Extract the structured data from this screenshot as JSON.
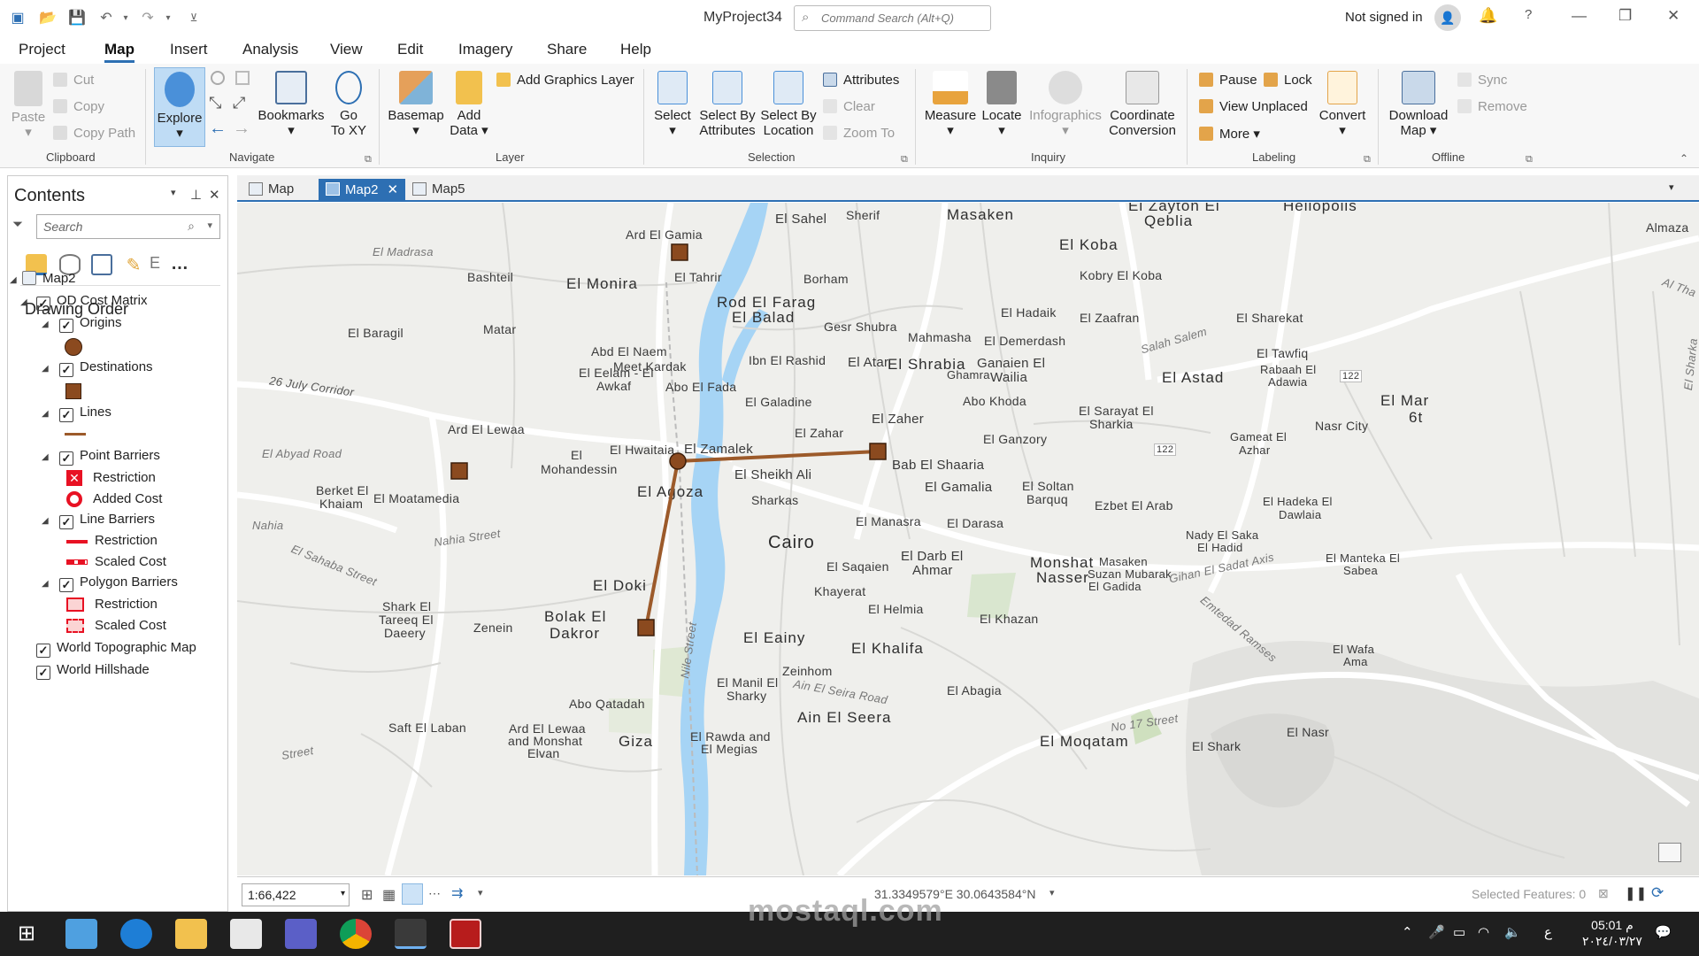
{
  "title_bar": {
    "project_name": "MyProject34",
    "command_search_placeholder": "Command Search (Alt+Q)",
    "sign_in": "Not signed in",
    "help": "?"
  },
  "menu": [
    "Project",
    "Map",
    "Insert",
    "Analysis",
    "View",
    "Edit",
    "Imagery",
    "Share",
    "Help"
  ],
  "active_menu": "Map",
  "ribbon": {
    "clipboard": {
      "label": "Clipboard",
      "paste": "Paste",
      "cut": "Cut",
      "copy": "Copy",
      "copy_path": "Copy Path"
    },
    "navigate": {
      "label": "Navigate",
      "explore": "Explore",
      "bookmarks": "Bookmarks",
      "go_to_xy_1": "Go",
      "go_to_xy_2": "To XY"
    },
    "layer": {
      "label": "Layer",
      "basemap": "Basemap",
      "add_data_1": "Add",
      "add_data_2": "Data",
      "add_graphics_layer": "Add Graphics Layer"
    },
    "selection": {
      "label": "Selection",
      "select": "Select",
      "select_by_attributes_1": "Select By",
      "select_by_attributes_2": "Attributes",
      "select_by_location_1": "Select By",
      "select_by_location_2": "Location",
      "attributes": "Attributes",
      "clear": "Clear",
      "zoom_to": "Zoom To"
    },
    "inquiry": {
      "label": "Inquiry",
      "measure": "Measure",
      "locate": "Locate",
      "infographics": "Infographics",
      "coordinate_conversion_1": "Coordinate",
      "coordinate_conversion_2": "Conversion"
    },
    "labeling": {
      "label": "Labeling",
      "pause": "Pause",
      "lock": "Lock",
      "view_unplaced": "View Unplaced",
      "more": "More",
      "convert": "Convert"
    },
    "offline": {
      "label": "Offline",
      "download_map_1": "Download",
      "download_map_2": "Map",
      "sync": "Sync",
      "remove": "Remove"
    }
  },
  "contents": {
    "title": "Contents",
    "search_placeholder": "Search",
    "drawing_order": "Drawing Order",
    "map_name": "Map2",
    "layers": {
      "od_cost_matrix": "OD Cost Matrix",
      "origins": "Origins",
      "destinations": "Destinations",
      "lines": "Lines",
      "point_barriers": "Point Barriers",
      "pb_restriction": "Restriction",
      "pb_added_cost": "Added Cost",
      "line_barriers": "Line Barriers",
      "lb_restriction": "Restriction",
      "lb_scaled_cost": "Scaled Cost",
      "polygon_barriers": "Polygon Barriers",
      "pgb_restriction": "Restriction",
      "pgb_scaled_cost": "Scaled Cost",
      "world_topo": "World Topographic Map",
      "world_hillshade": "World Hillshade"
    }
  },
  "map_tabs": [
    "Map",
    "Map2",
    "Map5"
  ],
  "active_tab": "Map2",
  "map_labels": {
    "el_sahel": "El Sahel",
    "sherif": "Sherif",
    "masaken": "Masaken",
    "el_zayton_qeblia_1": "El Zayton El",
    "el_zayton_qeblia_2": "Qeblia",
    "heliopolis": "Heliopolis",
    "almaza": "Almaza",
    "ard_el_gamia": "Ard El Gamia",
    "el_madrasa": "El Madrasa",
    "el_koba": "El Koba",
    "el_tahrir": "El Tahrir",
    "borham": "Borham",
    "kobry_el_koba": "Kobry El Koba",
    "al_tha": "Al Tha",
    "bashteil": "Bashteil",
    "el_monira": "El Monira",
    "rod_el_farag": "Rod El Farag",
    "el_balad": "El Balad",
    "el_hadaik": "El Hadaik",
    "el_zaafran": "El Zaafran",
    "el_sharekat": "El Sharekat",
    "el_baragil": "El Baragil",
    "matar": "Matar",
    "gesr_shubra": "Gesr Shubra",
    "mahmasha": "Mahmasha",
    "el_demerdash": "El Demerdash",
    "el_tawfiq": "El Tawfiq",
    "salah_salem": "Salah Salem",
    "abd_el_naem": "Abd El Naem",
    "ibn_el_rashid": "Ibn El Rashid",
    "el_atar": "El Atar",
    "el_shrabia": "El Shrabia",
    "ganaien_el": "Ganaien El",
    "wailia": "Wailia",
    "ghamra": "Ghamra",
    "rabaah_el": "Rabaah El",
    "adawia": "Adawia",
    "el_eelam_1": "El Eelam - El",
    "el_eelam_2": "Awkaf",
    "meet_kardak": "Meet Kardak",
    "abo_el_fada": "Abo El Fada",
    "el_astad": "El Astad",
    "el_mar": "El Mar",
    "sixt": "6t",
    "corridor_26": "26 July Corridor",
    "el_galadine": "El Galadine",
    "abo_khoda": "Abo Khoda",
    "el_sarayat_1": "El Sarayat El",
    "el_sarayat_2": "Sharkia",
    "nasr_city": "Nasr City",
    "ard_el_lewaa": "Ard El Lewaa",
    "el_zahar": "El Zahar",
    "el_zaher": "El Zaher",
    "el_ganzory": "El Ganzory",
    "gameat_1": "Gameat El",
    "gameat_2": "Azhar",
    "el_abyad_road": "El Abyad Road",
    "el_mohandessin_1": "El",
    "el_mohandessin_2": "Mohandessin",
    "el_hwaitaia": "El Hwaitaia",
    "el_zamalek": "El Zamalek",
    "bab_el_shaaria": "Bab El Shaaria",
    "el_sheikh_ali": "El Sheikh Ali",
    "berket_1": "Berket El",
    "berket_2": "Khaiam",
    "el_moatamedia": "El Moatamedia",
    "el_agoza": "El Agoza",
    "sharkas": "Sharkas",
    "el_gamalia": "El Gamalia",
    "el_soltan_1": "El Soltan",
    "el_soltan_2": "Barquq",
    "ezbet_el_arab": "Ezbet El Arab",
    "el_hadeka_1": "El Hadeka El",
    "el_hadeka_2": "Dawlaia",
    "nahia": "Nahia",
    "el_manasra": "El Manasra",
    "el_darasa": "El Darasa",
    "nahia_street": "Nahia Street",
    "cairo": "Cairo",
    "nady_1": "Nady El Saka",
    "nady_2": "El Hadid",
    "el_sahaba_street": "El Sahaba Street",
    "el_darb_1": "El Darb El",
    "el_darb_2": "Ahmar",
    "el_saqaien": "El Saqaien",
    "monshat_1": "Monshat",
    "monshat_2": "Nasser",
    "masaken_suzan_1": "Masaken",
    "masaken_suzan_2": "Suzan Mubarak",
    "el_gadida": "El Gadida",
    "gihan_el_sadat": "Gihan El Sadat Axis",
    "el_manteka_1": "El Manteka El",
    "el_manteka_2": "Sabea",
    "el_doki": "El Doki",
    "khayerat": "Khayerat",
    "shark_1": "Shark El",
    "shark_2": "Tareeq El",
    "shark_3": "Daeery",
    "zenein": "Zenein",
    "bolak_1": "Bolak El",
    "bolak_2": "Dakror",
    "el_helmia": "El Helmia",
    "el_khazan": "El Khazan",
    "emtedad_ramses": "Emtedad Ramses",
    "nile_street": "Nile Street",
    "el_eainy": "El Eainy",
    "el_khalifa": "El Khalifa",
    "el_wafa_1": "El Wafa",
    "el_wafa_2": "Ama",
    "zeinhom": "Zeinhom",
    "el_manil_1": "El Manil El",
    "el_manil_2": "Sharky",
    "ain_el_seira_road": "Ain El Seira Road",
    "el_abagia": "El Abagia",
    "abo_qatadah": "Abo Qatadah",
    "ain_el_seera": "Ain El Seera",
    "saft_el_laban": "Saft El Laban",
    "ard_el_lewaa2_1": "Ard El Lewaa",
    "ard_el_lewaa2_2": "and Monshat",
    "ard_el_lewaa2_3": "Elvan",
    "no_17_street": "No 17 Street",
    "el_nasr": "El Nasr",
    "giza": "Giza",
    "el_rawda_1": "El Rawda and",
    "el_rawda_2": "El Megias",
    "el_moqatam": "El Moqatam",
    "el_shark": "El Shark",
    "street": "Street",
    "route_122a": "122",
    "route_122b": "122",
    "el_sharka": "El Sharka"
  },
  "status_bar": {
    "scale": "1:66,422",
    "coordinates": "31.3349579°E 30.0643584°N",
    "selected_features": "Selected Features: 0"
  },
  "taskbar": {
    "time": "05:01 م",
    "date": "٢٠٢٤/٠٣/٢٧",
    "lang": "ع"
  },
  "watermark": {
    "brand": "mostaql.com"
  },
  "od_network": {
    "origin": "El Agoza",
    "destinations": [
      "El Tahrir",
      "El Moatamedia",
      "Bab El Shaaria",
      "Bolak El Dakror"
    ],
    "lines": [
      "El Agoza → Bab El Shaaria",
      "El Agoza → Bolak El Dakror"
    ]
  },
  "colors": {
    "accent": "#2d6fb3",
    "od_symbol": "#8b4a1f",
    "od_line": "#9c5a2a",
    "water": "#a6d4f5",
    "restriction": "#e81123"
  }
}
